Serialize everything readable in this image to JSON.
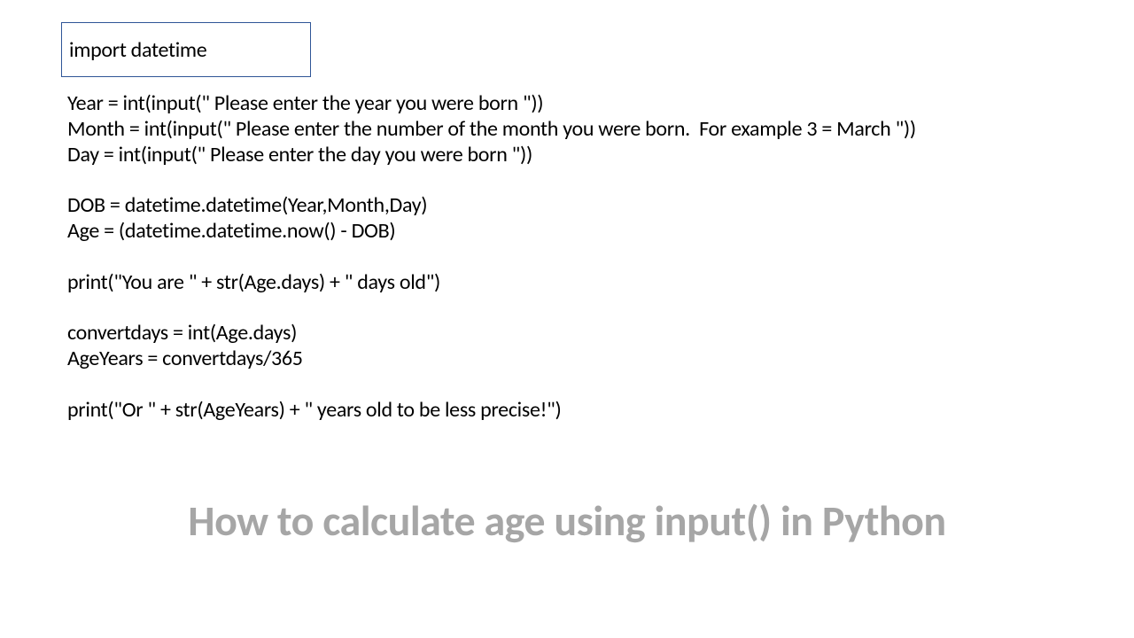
{
  "import_line": "import datetime",
  "code": "Year = int(input(\" Please enter the year you were born \"))\nMonth = int(input(\" Please enter the number of the month you were born.  For example 3 = March \"))\nDay = int(input(\" Please enter the day you were born \"))\n\nDOB = datetime.datetime(Year,Month,Day)\nAge = (datetime.datetime.now() - DOB)\n\nprint(\"You are \" + str(Age.days) + \" days old\")\n\nconvertdays = int(Age.days)\nAgeYears = convertdays/365\n\nprint(\"Or \" + str(AgeYears) + \" years old to be less precise!\")",
  "title": "How to calculate age using input() in Python"
}
